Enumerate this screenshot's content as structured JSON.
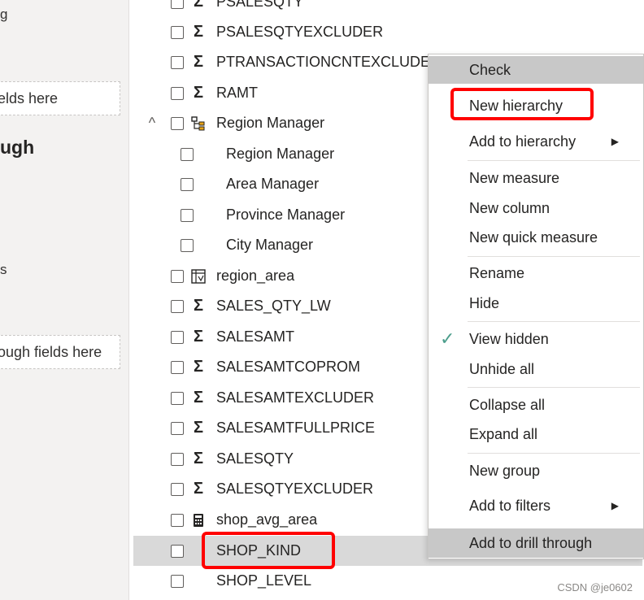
{
  "left_panel": {
    "frag_top": "g",
    "drop_fields": "elds here",
    "heading": "ugh",
    "frag_s": "s",
    "drop_drill": "ough fields here"
  },
  "fields": [
    {
      "label": "PSALESQTY",
      "icon": "sigma-icon"
    },
    {
      "label": "PSALESQTYEXCLUDER",
      "icon": "sigma-icon"
    },
    {
      "label": "PTRANSACTIONCNTEXCLUDER",
      "icon": "sigma-icon"
    },
    {
      "label": "RAMT",
      "icon": "sigma-icon"
    },
    {
      "label": "Region Manager",
      "icon": "hierarchy-icon",
      "expanded": true
    },
    {
      "label": "Region Manager",
      "child": true
    },
    {
      "label": "Area Manager",
      "child": true
    },
    {
      "label": "Province Manager",
      "child": true
    },
    {
      "label": "City Manager",
      "child": true
    },
    {
      "label": "region_area",
      "icon": "calc-column-icon"
    },
    {
      "label": "SALES_QTY_LW",
      "icon": "sigma-icon"
    },
    {
      "label": "SALESAMT",
      "icon": "sigma-icon"
    },
    {
      "label": "SALESAMTCOPROM",
      "icon": "sigma-icon"
    },
    {
      "label": "SALESAMTEXCLUDER",
      "icon": "sigma-icon"
    },
    {
      "label": "SALESAMTFULLPRICE",
      "icon": "sigma-icon"
    },
    {
      "label": "SALESQTY",
      "icon": "sigma-icon"
    },
    {
      "label": "SALESQTYEXCLUDER",
      "icon": "sigma-icon"
    },
    {
      "label": "shop_avg_area",
      "icon": "calculator-icon"
    },
    {
      "label": "SHOP_KIND",
      "selected": true
    },
    {
      "label": "SHOP_LEVEL"
    }
  ],
  "menu": {
    "check": "Check",
    "new_hierarchy": "New hierarchy",
    "add_to_hierarchy": "Add to hierarchy",
    "new_measure": "New measure",
    "new_column": "New column",
    "new_quick_measure": "New quick measure",
    "rename": "Rename",
    "hide": "Hide",
    "view_hidden": "View hidden",
    "unhide_all": "Unhide all",
    "collapse_all": "Collapse all",
    "expand_all": "Expand all",
    "new_group": "New group",
    "add_to_filters": "Add to filters",
    "add_to_drill_through": "Add to drill through"
  },
  "watermark": "CSDN @je0602",
  "colors": {
    "highlight": "#ff0000",
    "check": "#4c9e8c",
    "menu_grey": "#c8c8c8",
    "selected_row": "#d9d9d9"
  }
}
